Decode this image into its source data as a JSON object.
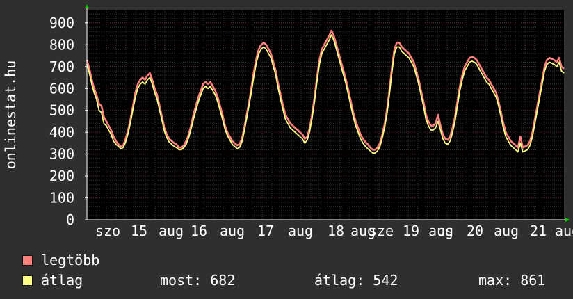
{
  "chart_data": {
    "type": "line",
    "ylabel": "onlinestat.hu",
    "ylim": [
      0,
      960
    ],
    "yticks": [
      0,
      100,
      200,
      300,
      400,
      500,
      600,
      700,
      800,
      900
    ],
    "xticks": [
      "szo",
      "15",
      "aug",
      "16",
      "aug",
      "17",
      "aug",
      "18",
      "aug",
      "sze",
      "19",
      "aug",
      "cs",
      "20",
      "aug",
      "21",
      "aug"
    ],
    "grid": true,
    "series": [
      {
        "name": "legtöbb",
        "color": "#ff7f7f",
        "values": [
          730,
          690,
          640,
          600,
          570,
          530,
          520,
          470,
          450,
          430,
          410,
          380,
          360,
          345,
          335,
          340,
          370,
          410,
          460,
          520,
          580,
          620,
          640,
          650,
          640,
          660,
          670,
          640,
          600,
          570,
          520,
          470,
          420,
          390,
          370,
          360,
          350,
          345,
          330,
          330,
          340,
          360,
          390,
          430,
          480,
          520,
          560,
          590,
          620,
          630,
          620,
          630,
          610,
          590,
          560,
          520,
          480,
          430,
          400,
          380,
          360,
          350,
          340,
          345,
          370,
          420,
          480,
          540,
          610,
          680,
          740,
          780,
          800,
          810,
          800,
          780,
          760,
          720,
          680,
          620,
          570,
          520,
          480,
          460,
          440,
          430,
          420,
          410,
          400,
          390,
          370,
          380,
          420,
          480,
          560,
          650,
          730,
          780,
          800,
          820,
          840,
          865,
          840,
          800,
          760,
          720,
          680,
          640,
          590,
          540,
          490,
          450,
          420,
          390,
          370,
          355,
          345,
          330,
          320,
          320,
          330,
          350,
          390,
          440,
          510,
          600,
          700,
          780,
          810,
          810,
          790,
          780,
          770,
          760,
          740,
          720,
          680,
          640,
          590,
          540,
          480,
          450,
          430,
          430,
          440,
          480,
          430,
          390,
          370,
          365,
          380,
          420,
          470,
          540,
          610,
          660,
          700,
          720,
          740,
          745,
          740,
          730,
          710,
          690,
          670,
          650,
          640,
          620,
          600,
          580,
          540,
          490,
          440,
          400,
          380,
          360,
          350,
          340,
          330,
          380,
          330,
          335,
          340,
          360,
          400,
          460,
          520,
          580,
          640,
          700,
          730,
          740,
          735,
          730,
          720,
          740,
          700,
          690
        ]
      },
      {
        "name": "átlag",
        "color": "#ffff80",
        "values": [
          710,
          670,
          620,
          580,
          550,
          500,
          490,
          440,
          430,
          410,
          390,
          360,
          345,
          335,
          325,
          330,
          355,
          395,
          445,
          505,
          560,
          600,
          620,
          630,
          620,
          640,
          650,
          620,
          580,
          550,
          500,
          455,
          405,
          375,
          355,
          345,
          335,
          330,
          320,
          320,
          330,
          345,
          375,
          415,
          460,
          500,
          540,
          570,
          600,
          610,
          600,
          610,
          590,
          570,
          540,
          500,
          460,
          415,
          385,
          365,
          345,
          335,
          325,
          330,
          355,
          405,
          465,
          525,
          590,
          660,
          720,
          760,
          780,
          790,
          780,
          760,
          740,
          700,
          660,
          600,
          550,
          500,
          460,
          440,
          420,
          410,
          400,
          390,
          380,
          370,
          350,
          365,
          405,
          465,
          540,
          630,
          710,
          760,
          780,
          800,
          820,
          845,
          820,
          780,
          740,
          700,
          660,
          620,
          570,
          520,
          470,
          430,
          400,
          370,
          350,
          335,
          325,
          315,
          305,
          305,
          315,
          335,
          375,
          425,
          490,
          580,
          680,
          760,
          790,
          790,
          770,
          760,
          750,
          740,
          720,
          700,
          660,
          620,
          570,
          520,
          460,
          430,
          410,
          410,
          420,
          450,
          410,
          370,
          350,
          345,
          360,
          400,
          450,
          520,
          590,
          640,
          680,
          700,
          720,
          725,
          720,
          710,
          690,
          670,
          650,
          630,
          620,
          600,
          580,
          560,
          520,
          470,
          420,
          380,
          360,
          340,
          330,
          320,
          310,
          350,
          310,
          315,
          320,
          340,
          380,
          440,
          500,
          560,
          620,
          680,
          710,
          720,
          715,
          710,
          700,
          720,
          680,
          670
        ]
      }
    ]
  },
  "legend": {
    "max_label": "legtöbb",
    "avg_label": "átlag",
    "most": "most: 682",
    "atlag": "átlag: 542",
    "max": "max: 861"
  },
  "colors": {
    "background": "#2f2f2f",
    "plot_bg": "#000000",
    "grid": "#444444",
    "axis": "#ffffff",
    "arrow": "#00cc00"
  }
}
